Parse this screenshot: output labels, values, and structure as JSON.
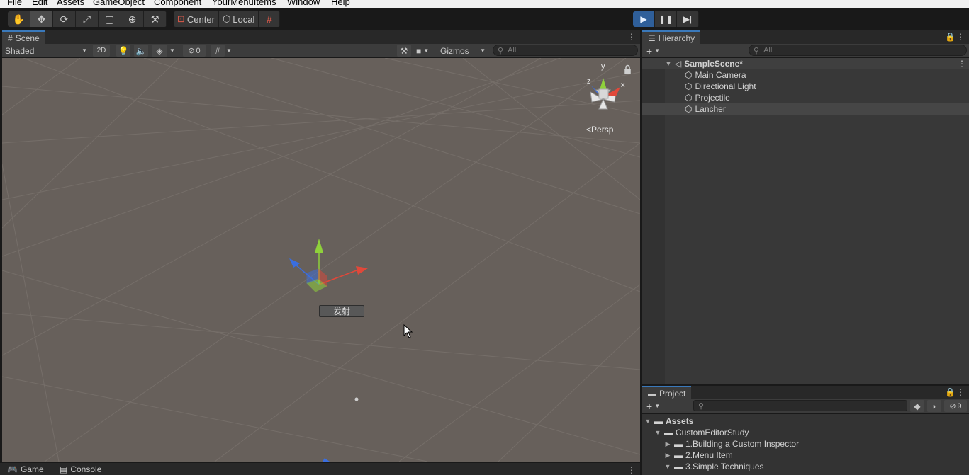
{
  "menu": [
    "File",
    "Edit",
    "Assets",
    "GameObject",
    "Component",
    "YourMenuItems",
    "Window",
    "Help"
  ],
  "toolbar": {
    "tools": [
      "hand-tool",
      "move-tool",
      "rotate-tool",
      "scale-tool",
      "rect-tool",
      "transform-tool",
      "custom-tool"
    ],
    "pivot_label": "Center",
    "space_label": "Local"
  },
  "scene": {
    "tab_label": "Scene",
    "shading_mode": "Shaded",
    "mode_2d": "2D",
    "hidden_count": "0",
    "gizmos_label": "Gizmos",
    "search_placeholder": "All",
    "fire_button_label": "发射",
    "projection_label": "Persp",
    "gizmo_axes": {
      "y": "y",
      "x": "x",
      "z": "z"
    }
  },
  "bottom_tabs": {
    "game": "Game",
    "console": "Console"
  },
  "hierarchy": {
    "tab_label": "Hierarchy",
    "search_placeholder": "All",
    "scene_name": "SampleScene*",
    "items": [
      "Main Camera",
      "Directional Light",
      "Projectile",
      "Lancher"
    ],
    "selected": "Lancher"
  },
  "project": {
    "tab_label": "Project",
    "hidden_count": "9",
    "tree": {
      "root": "Assets",
      "folder": "CustomEditorStudy",
      "children": [
        "1.Building a Custom Inspector",
        "2.Menu Item",
        "3.Simple Techniques"
      ]
    }
  },
  "colors": {
    "play_active": "#2f5f9a",
    "scene_bg": "#67605b",
    "tab_accent": "#3a79bb",
    "axis_x": "#e0483a",
    "axis_y": "#8fd13b",
    "axis_z": "#3a6ee0"
  }
}
